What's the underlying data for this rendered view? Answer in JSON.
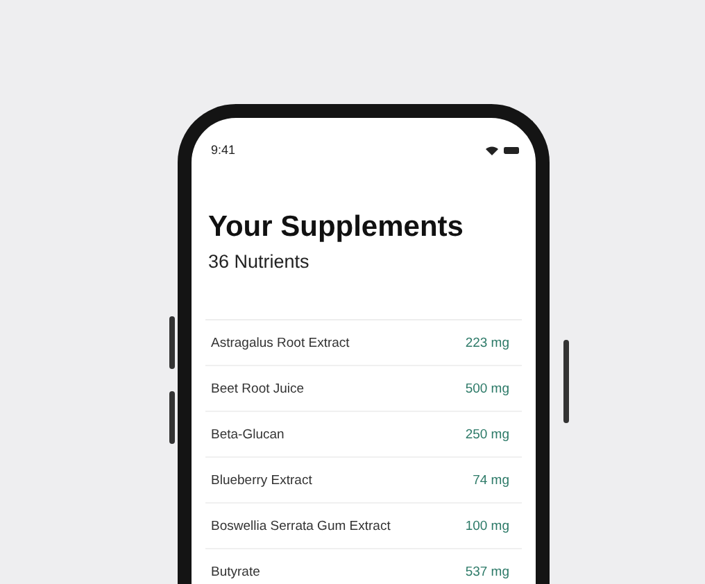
{
  "status_bar": {
    "time": "9:41"
  },
  "header": {
    "title": "Your Supplements",
    "subtitle": "36 Nutrients"
  },
  "nutrients": [
    {
      "name": "Astragalus Root Extract",
      "amount": "223 mg"
    },
    {
      "name": "Beet Root Juice",
      "amount": "500 mg"
    },
    {
      "name": "Beta-Glucan",
      "amount": "250 mg"
    },
    {
      "name": "Blueberry Extract",
      "amount": "74 mg"
    },
    {
      "name": "Boswellia Serrata Gum Extract",
      "amount": "100 mg"
    },
    {
      "name": "Butyrate",
      "amount": "537 mg"
    }
  ]
}
